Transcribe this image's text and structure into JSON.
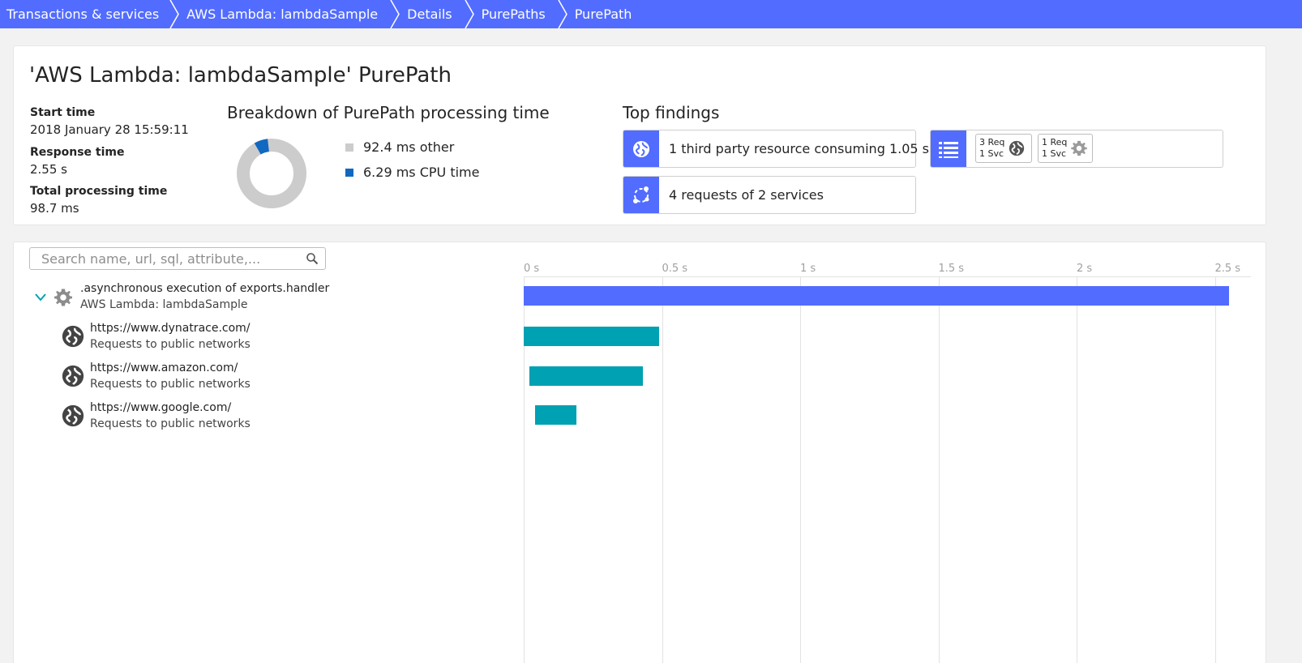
{
  "breadcrumb": [
    {
      "label": "Transactions & services"
    },
    {
      "label": "AWS Lambda: lambdaSample"
    },
    {
      "label": "Details"
    },
    {
      "label": "PurePaths"
    },
    {
      "label": "PurePath"
    }
  ],
  "header": {
    "title": "'AWS Lambda: lambdaSample' PurePath",
    "start_time_label": "Start time",
    "start_time_value": "2018 January 28 15:59:11",
    "response_time_label": "Response time",
    "response_time_value": "2.55 s",
    "total_processing_label": "Total processing time",
    "total_processing_value": "98.7 ms"
  },
  "breakdown": {
    "title": "Breakdown of PurePath processing time",
    "items": [
      {
        "label": "92.4 ms other",
        "value_ms": 92.4,
        "color": "#cccccc"
      },
      {
        "label": "6.29 ms CPU time",
        "value_ms": 6.29,
        "color": "#1168c0"
      }
    ]
  },
  "findings": {
    "title": "Top findings",
    "items": [
      {
        "text": "1 third party resource consuming 1.05 s",
        "icon": "globe-icon"
      },
      {
        "text": "4 requests of 2 services",
        "icon": "services-icon"
      }
    ],
    "summary": {
      "icon": "list-icon",
      "boxes": [
        {
          "line1": "3 Req",
          "line2": "1 Svc",
          "icon": "globe-icon"
        },
        {
          "line1": "1 Req",
          "line2": "1 Svc",
          "icon": "gear-icon"
        }
      ]
    }
  },
  "search": {
    "placeholder": "Search name, url, sql, attribute,..."
  },
  "timeline": {
    "ticks": [
      "0 s",
      "0.5 s",
      "1 s",
      "1.5 s",
      "2 s",
      "2.5 s"
    ],
    "max_seconds": 2.5,
    "rows": [
      {
        "name": ".asynchronous execution of exports.handler",
        "sub": "AWS Lambda: lambdaSample",
        "icon": "gear-icon",
        "start_s": 0,
        "duration_s": 2.55,
        "color": "#526cff",
        "expandable": true
      },
      {
        "name": "https://www.dynatrace.com/",
        "sub": "Requests to public networks",
        "icon": "globe-icon",
        "start_s": 0,
        "duration_s": 0.49,
        "color": "#00a1b2"
      },
      {
        "name": "https://www.amazon.com/",
        "sub": "Requests to public networks",
        "icon": "globe-icon",
        "start_s": 0.02,
        "duration_s": 0.41,
        "color": "#00a1b2"
      },
      {
        "name": "https://www.google.com/",
        "sub": "Requests to public networks",
        "icon": "globe-icon",
        "start_s": 0.04,
        "duration_s": 0.15,
        "color": "#00a1b2"
      }
    ]
  }
}
